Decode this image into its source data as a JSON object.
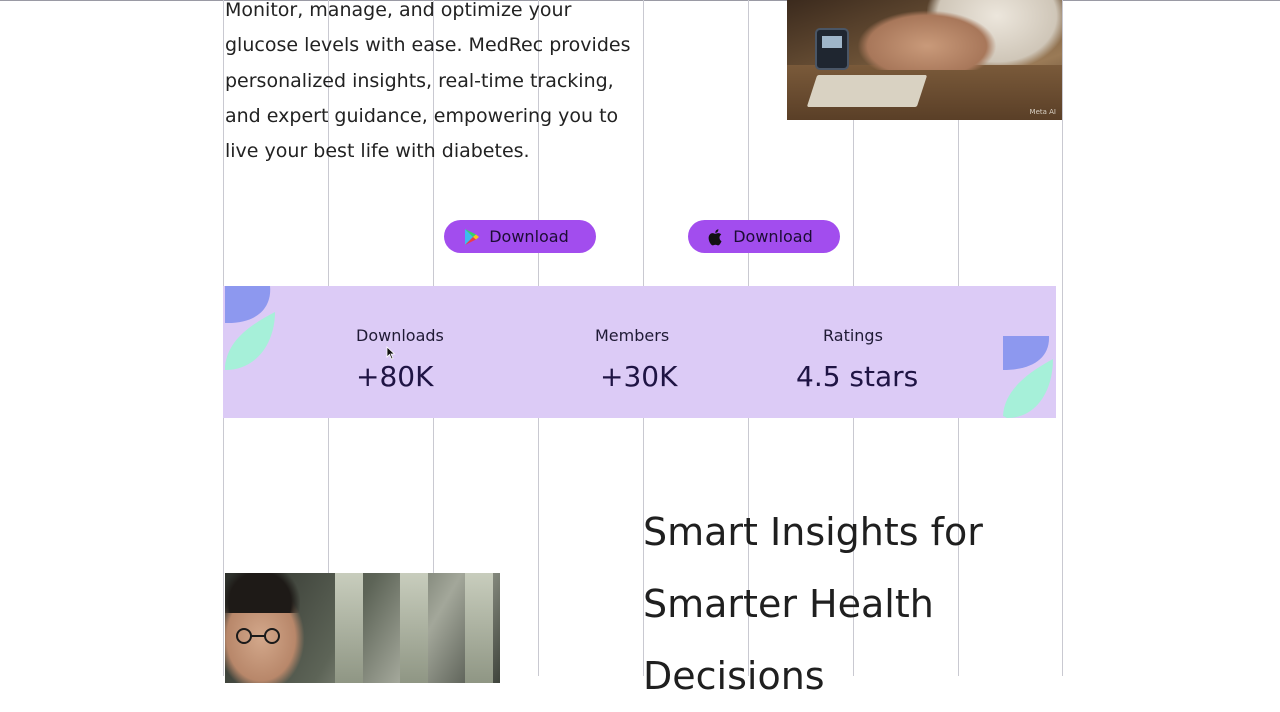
{
  "hero": {
    "body": "Monitor, manage, and optimize your glucose levels with ease. MedRec provides personalized insights, real-time tracking, and expert guidance, empowering you to live your best life with diabetes.",
    "image_watermark": "Meta AI"
  },
  "downloads": {
    "google_play": {
      "label": "Download",
      "icon": "google-play-icon"
    },
    "app_store": {
      "label": "Download",
      "icon": "apple-icon"
    },
    "button_color": "#a24dee"
  },
  "stats": {
    "background": "#dccbf6",
    "items": [
      {
        "label": "Downloads",
        "value": "+80K"
      },
      {
        "label": "Members",
        "value": "+30K"
      },
      {
        "label": "Ratings",
        "value": "4.5 stars"
      }
    ]
  },
  "section": {
    "title_lines": [
      "Smart Insights for",
      "Smarter Health",
      "Decisions"
    ]
  }
}
